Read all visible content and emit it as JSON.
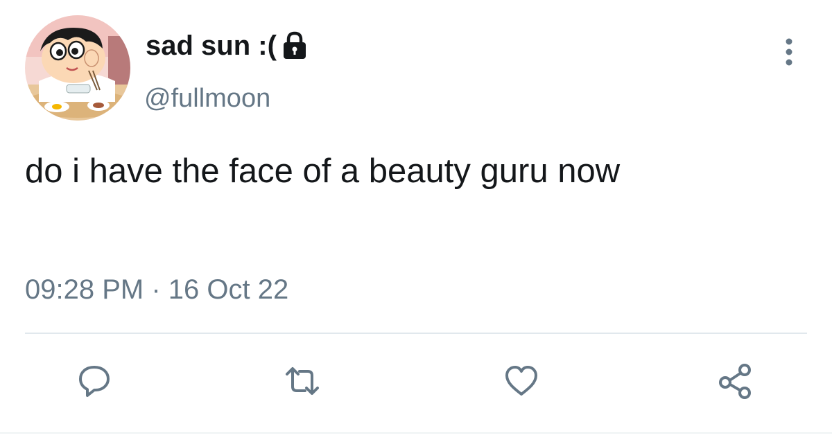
{
  "tweet": {
    "display_name": "sad sun :(",
    "handle": "@fullmoon",
    "text": "do i have the face of a beauty guru now",
    "timestamp": "09:28 PM · 16 Oct 22"
  },
  "icons": {
    "avatar": "cartoon-boy-avatar",
    "lock": "lock-icon",
    "more": "more-vertical-icon",
    "reply": "reply-icon",
    "retweet": "retweet-icon",
    "like": "heart-icon",
    "share": "share-icon"
  },
  "colors": {
    "text_primary": "#14171a",
    "text_secondary": "#657786",
    "icon": "#657786",
    "divider": "#e1e8ed"
  }
}
